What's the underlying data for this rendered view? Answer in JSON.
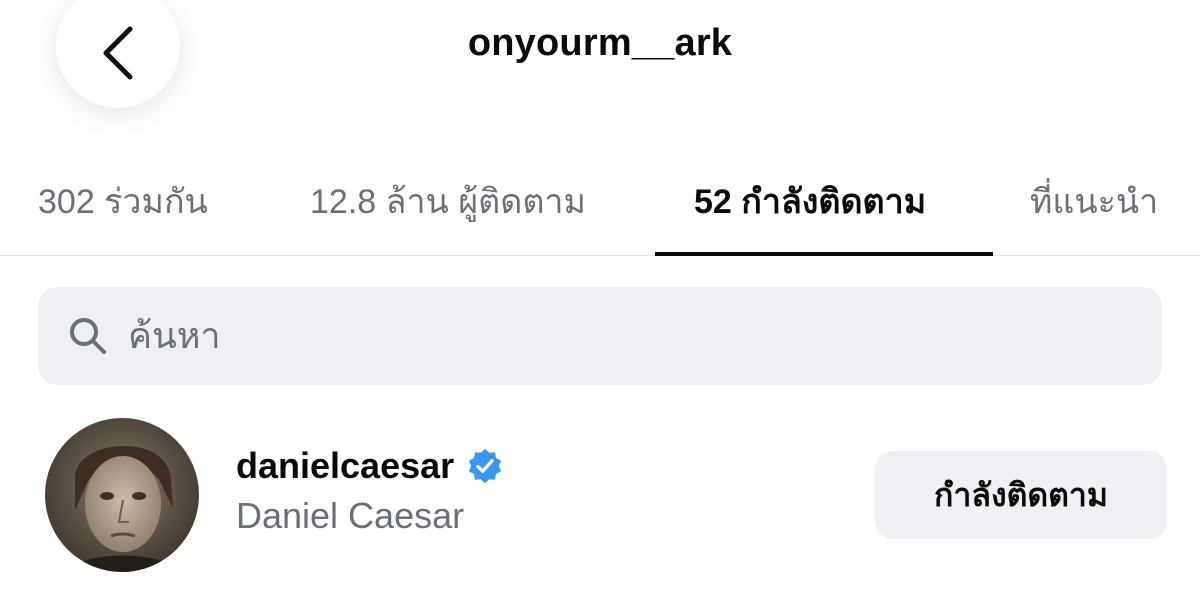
{
  "header": {
    "title": "onyourm__ark",
    "back_icon": "chevron-left-icon"
  },
  "tabs": [
    {
      "label": "302 ร่วมกัน",
      "active": false
    },
    {
      "label": "12.8 ล้าน ผู้ติดตาม",
      "active": false
    },
    {
      "label": "52 กำลังติดตาม",
      "active": true
    },
    {
      "label": "ที่แนะนำ",
      "active": false
    }
  ],
  "search": {
    "placeholder": "ค้นหา",
    "value": "",
    "icon": "search-icon"
  },
  "list": [
    {
      "username": "danielcaesar",
      "full_name": "Daniel Caesar",
      "verified": true,
      "button_label": "กำลังติดตาม"
    }
  ],
  "colors": {
    "text_primary": "#0a0a0a",
    "text_secondary": "#6b6f76",
    "surface_gray": "#eff0f3",
    "verified_blue": "#3897f0",
    "divider": "#e6e6e8"
  }
}
